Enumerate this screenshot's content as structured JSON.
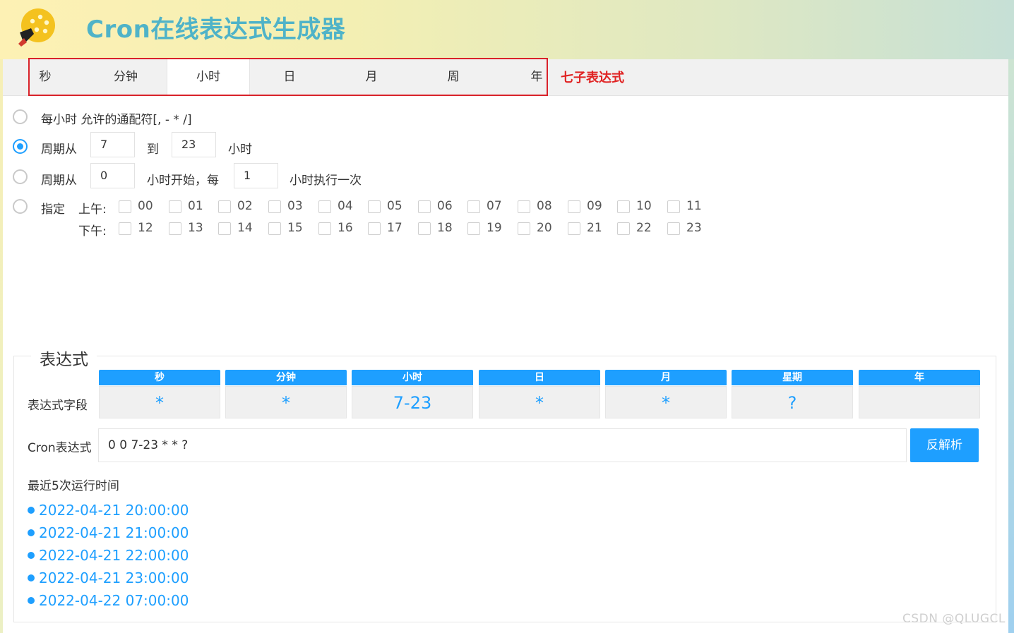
{
  "header": {
    "title": "Cron在线表达式生成器",
    "logo_icon": "palette-brush-icon"
  },
  "tabs": [
    "秒",
    "分钟",
    "小时",
    "日",
    "月",
    "周",
    "年"
  ],
  "active_tab": "小时",
  "tab_note": "七子表达式",
  "options": {
    "every": "每小时 允许的通配符[, - * /]",
    "cycle_label": "周期从",
    "cycle_from": "7",
    "cycle_to_label": "到",
    "cycle_to": "23",
    "cycle_unit": "小时",
    "interval_label": "周期从",
    "interval_start": "0",
    "interval_mid": "小时开始，每",
    "interval_step": "1",
    "interval_end": "小时执行一次",
    "specify_label": "指定",
    "am_label": "上午:",
    "pm_label": "下午:",
    "am_hours": [
      "00",
      "01",
      "02",
      "03",
      "04",
      "05",
      "06",
      "07",
      "08",
      "09",
      "10",
      "11"
    ],
    "pm_hours": [
      "12",
      "13",
      "14",
      "15",
      "16",
      "17",
      "18",
      "19",
      "20",
      "21",
      "22",
      "23"
    ],
    "selected_option": "cycle"
  },
  "expression": {
    "legend": "表达式",
    "fields_label": "表达式字段",
    "columns": [
      {
        "head": "秒",
        "value": "*"
      },
      {
        "head": "分钟",
        "value": "*"
      },
      {
        "head": "小时",
        "value": "7-23"
      },
      {
        "head": "日",
        "value": "*"
      },
      {
        "head": "月",
        "value": "*"
      },
      {
        "head": "星期",
        "value": "?"
      },
      {
        "head": "年",
        "value": ""
      }
    ],
    "cron_label": "Cron表达式",
    "cron_value": "0 0 7-23 * * ?",
    "parse_button": "反解析",
    "recent_label": "最近5次运行时间",
    "recent_runs": [
      "2022-04-21 20:00:00",
      "2022-04-21 21:00:00",
      "2022-04-21 22:00:00",
      "2022-04-21 23:00:00",
      "2022-04-22 07:00:00"
    ]
  },
  "watermark": "CSDN @QLUGCL",
  "colors": {
    "accent": "#1e9fff",
    "title": "#4fb3c8",
    "highlight": "#e02424"
  }
}
